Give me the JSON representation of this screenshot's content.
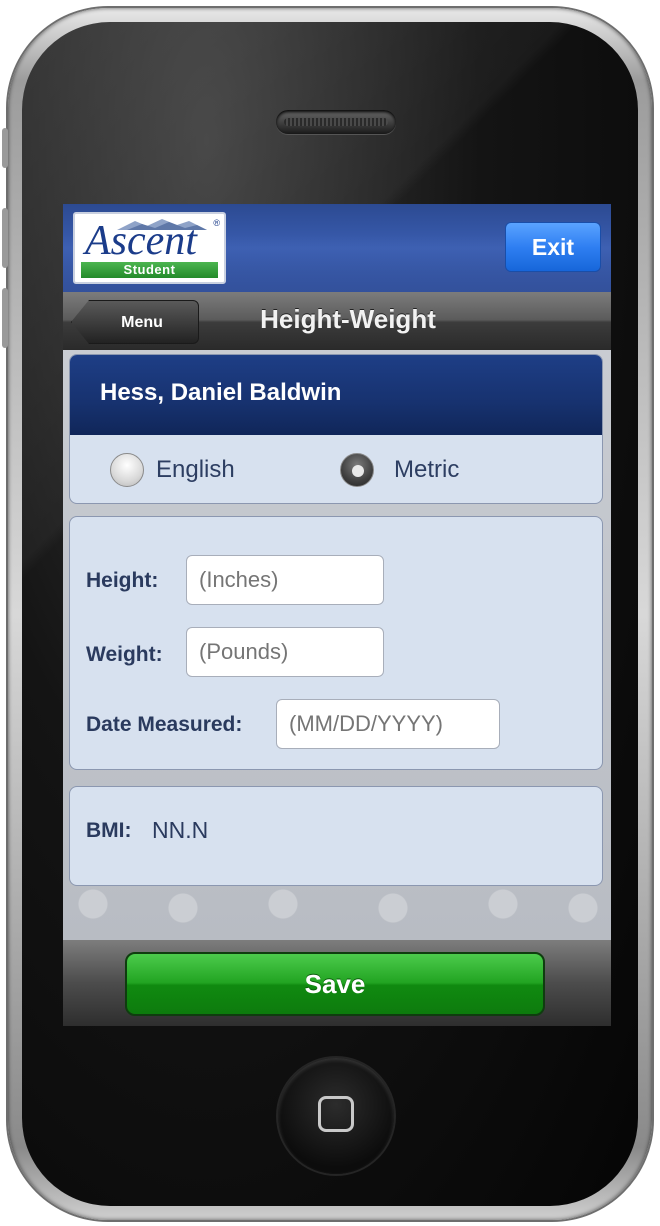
{
  "app": {
    "logo_text": "Ascent",
    "logo_subtext": "Student",
    "logo_reg": "®"
  },
  "header": {
    "exit_label": "Exit"
  },
  "nav": {
    "back_label": "Menu",
    "title": "Height-Weight"
  },
  "student": {
    "name": "Hess, Daniel Baldwin"
  },
  "units": {
    "options": [
      {
        "label": "English",
        "selected": false
      },
      {
        "label": "Metric",
        "selected": true
      }
    ]
  },
  "form": {
    "height": {
      "label": "Height:",
      "placeholder": "(Inches)"
    },
    "weight": {
      "label": "Weight:",
      "placeholder": "(Pounds)"
    },
    "date": {
      "label": "Date Measured:",
      "placeholder": "(MM/DD/YYYY)"
    }
  },
  "bmi": {
    "label": "BMI:",
    "value": "NN.N"
  },
  "footer": {
    "save_label": "Save"
  },
  "colors": {
    "header_blue": "#2c4a92",
    "exit_blue": "#2f7ff2",
    "save_green": "#22a422",
    "card_bg": "#d7e1ef",
    "name_header": "#17326f"
  }
}
